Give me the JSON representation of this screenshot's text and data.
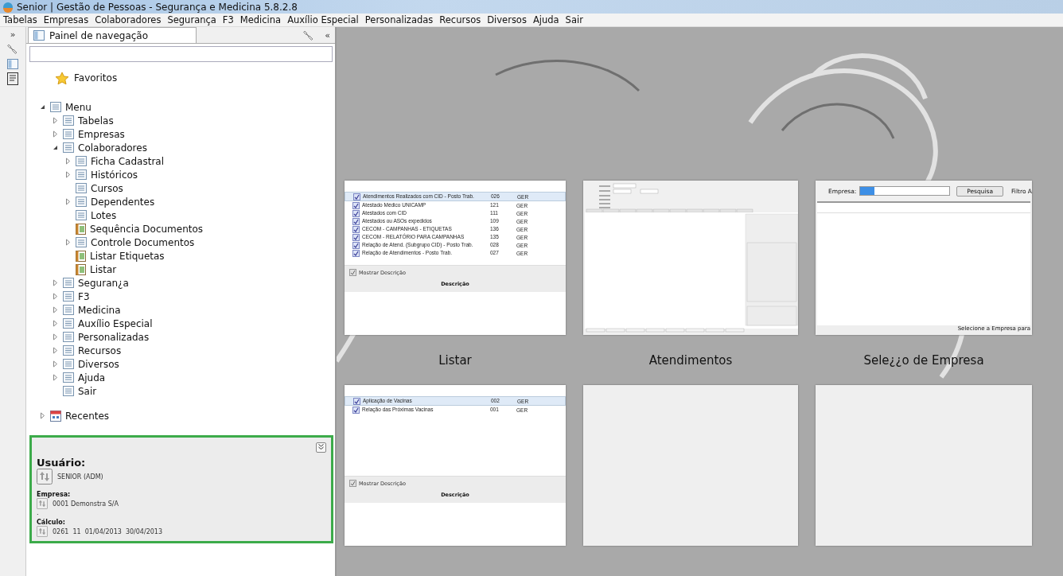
{
  "window": {
    "title": "Senior | Gestão de Pessoas - Segurança e Medicina 5.8.2.8"
  },
  "menu_bar": [
    "Tabelas",
    "Empresas",
    "Colaboradores",
    "Segurança",
    "F3",
    "Medicina",
    "Auxílio Especial",
    "Personalizadas",
    "Recursos",
    "Diversos",
    "Ajuda",
    "Sair"
  ],
  "side_strip": {
    "expand_glyph": "»"
  },
  "nav_panel": {
    "tab": {
      "label": "Painel de navegação",
      "selected": true
    },
    "collapse_glyph": "«",
    "favorites": "Favoritos",
    "tree": [
      {
        "label": "Menu",
        "kind": "folder",
        "expanded": true,
        "children": [
          {
            "label": "Tabelas",
            "kind": "folder",
            "expanded": false
          },
          {
            "label": "Empresas",
            "kind": "folder",
            "expanded": false
          },
          {
            "label": "Colaboradores",
            "kind": "folder",
            "expanded": true,
            "children": [
              {
                "label": "Ficha Cadastral",
                "kind": "folder",
                "expanded": false
              },
              {
                "label": "Históricos",
                "kind": "folder",
                "expanded": false
              },
              {
                "label": "Cursos",
                "kind": "leaf"
              },
              {
                "label": "Dependentes",
                "kind": "folder",
                "expanded": false
              },
              {
                "label": "Lotes",
                "kind": "leaf"
              },
              {
                "label": "Sequência Documentos",
                "kind": "report"
              },
              {
                "label": "Controle Documentos",
                "kind": "folder",
                "expanded": false
              },
              {
                "label": "Listar Etiquetas",
                "kind": "report"
              },
              {
                "label": "Listar",
                "kind": "report"
              }
            ]
          },
          {
            "label": "Seguran¿a",
            "kind": "folder",
            "expanded": false
          },
          {
            "label": "F3",
            "kind": "folder",
            "expanded": false
          },
          {
            "label": "Medicina",
            "kind": "folder",
            "expanded": false
          },
          {
            "label": "Auxílio Especial",
            "kind": "folder",
            "expanded": false
          },
          {
            "label": "Personalizadas",
            "kind": "folder",
            "expanded": false
          },
          {
            "label": "Recursos",
            "kind": "folder",
            "expanded": false
          },
          {
            "label": "Diversos",
            "kind": "folder",
            "expanded": false
          },
          {
            "label": "Ajuda",
            "kind": "folder",
            "expanded": false
          },
          {
            "label": "Sair",
            "kind": "leaf"
          }
        ]
      }
    ],
    "recent": {
      "label": "Recentes",
      "expanded": false
    },
    "info": {
      "user_label": "Usuário:",
      "user": "SENIOR (ADM)",
      "company_label": "Empresa:",
      "company": "0001  Demonstra S/A",
      "note": ".",
      "calc_label": "Cálculo:",
      "calc": "0261  11  01/04/2013  30/04/2013"
    }
  },
  "thumbnails": [
    {
      "kind": "report-list",
      "caption": "Listar",
      "rows": [
        {
          "name": "Atendimentos Realizados com CID - Posto Trab.",
          "code": "026",
          "group": "GER",
          "checked": true,
          "selected": true
        },
        {
          "name": "Atestado Médico UNICAMP",
          "code": "121",
          "group": "GER",
          "checked": true,
          "selected": false
        },
        {
          "name": "Atestados com CID",
          "code": "111",
          "group": "GER",
          "checked": true,
          "selected": false
        },
        {
          "name": "Atestados ou ASOs expedidos",
          "code": "109",
          "group": "GER",
          "checked": true,
          "selected": false
        },
        {
          "name": "CECOM - CAMPANHAS - ETIQUETAS",
          "code": "136",
          "group": "GER",
          "checked": true,
          "selected": false
        },
        {
          "name": "CECOM - RELATÓRIO PARA CAMPANHAS",
          "code": "135",
          "group": "GER",
          "checked": true,
          "selected": false
        },
        {
          "name": "Relação de Atend. (Subgrupo CID) - Posto Trab.",
          "code": "028",
          "group": "GER",
          "checked": true,
          "selected": false
        },
        {
          "name": "Relação de Atendimentos - Posto Trab.",
          "code": "027",
          "group": "GER",
          "checked": true,
          "selected": false
        }
      ],
      "show_description": {
        "label": "Mostrar Descrição",
        "checked": true
      },
      "description_header": "Descrição"
    },
    {
      "kind": "form",
      "caption": "Atendimentos"
    },
    {
      "kind": "company-select",
      "caption": "Sele¿¿o de Empresa",
      "field_label": "Empresa:",
      "button": "Pesquisa",
      "filter_label": "Filtro A",
      "status": "Selecione a Empresa para"
    },
    {
      "kind": "report-list",
      "rows": [
        {
          "name": "Aplicação de Vacinas",
          "code": "002",
          "group": "GER",
          "checked": true,
          "selected": true
        },
        {
          "name": "Relação das Próximas Vacinas",
          "code": "001",
          "group": "GER",
          "checked": true,
          "selected": false
        }
      ],
      "show_description": {
        "label": "Mostrar Descrição",
        "checked": true
      },
      "description_header": "Descrição"
    },
    {
      "kind": "empty"
    },
    {
      "kind": "empty"
    }
  ]
}
